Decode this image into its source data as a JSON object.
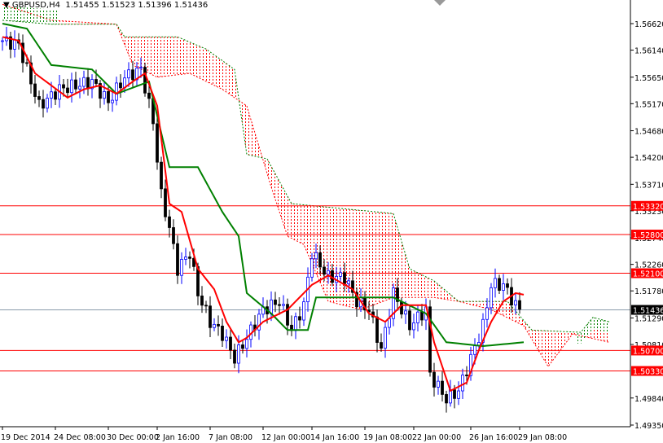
{
  "header": {
    "symbol": "GBPUSD,H4",
    "ohlc": "1.51455 1.51523 1.51396 1.51436"
  },
  "colors": {
    "bull": "#0000ff",
    "bear": "#000000",
    "tenkan": "#ff0000",
    "kijun": "#008000",
    "cloud_bear": "#ff0000",
    "cloud_bull": "#008000",
    "level": "#ff0000",
    "current": "#000000"
  },
  "chart_data": {
    "type": "candlestick",
    "title": "GBPUSD,H4",
    "ylim": [
      1.4935,
      1.5697
    ],
    "y_ticks": [
      "1.56620",
      "1.56140",
      "1.55650",
      "1.55170",
      "1.54680",
      "1.54200",
      "1.53710",
      "1.53230",
      "1.52740",
      "1.52260",
      "1.51780",
      "1.51290",
      "1.50810",
      "1.49840",
      "1.49350"
    ],
    "y_tick_values": [
      1.5662,
      1.5614,
      1.5565,
      1.5517,
      1.5468,
      1.542,
      1.5371,
      1.5323,
      1.5274,
      1.5226,
      1.5178,
      1.5129,
      1.5081,
      1.4984,
      1.4935
    ],
    "x_ticks": [
      "19 Dec 2014",
      "24 Dec 08:00",
      "30 Dec 00:00",
      "2 Jan 16:00",
      "7 Jan 08:00",
      "12 Jan 00:00",
      "14 Jan 16:00",
      "19 Jan 08:00",
      "22 Jan 00:00",
      "26 Jan 16:00",
      "29 Jan 08:00"
    ],
    "x_tick_bar_index": [
      0,
      13,
      26,
      38,
      51,
      64,
      76,
      89,
      101,
      115,
      127
    ],
    "levels": [
      {
        "value": 1.5332,
        "label": "1.53320"
      },
      {
        "value": 1.528,
        "label": "1.52800"
      },
      {
        "value": 1.521,
        "label": "1.52100"
      },
      {
        "value": 1.507,
        "label": "1.50700"
      },
      {
        "value": 1.5033,
        "label": "1.50330"
      }
    ],
    "current": {
      "value": 1.51436,
      "label": "1.51436"
    },
    "close_path": [
      [
        0,
        1.5631
      ],
      [
        4,
        1.5624
      ],
      [
        9,
        1.5513
      ],
      [
        14,
        1.5543
      ],
      [
        22,
        1.5557
      ],
      [
        26,
        1.552
      ],
      [
        30,
        1.5565
      ],
      [
        34,
        1.5579
      ],
      [
        37,
        1.5484
      ],
      [
        39,
        1.5351
      ],
      [
        41,
        1.5292
      ],
      [
        43,
        1.5218
      ],
      [
        46,
        1.5247
      ],
      [
        48,
        1.5174
      ],
      [
        51,
        1.5122
      ],
      [
        54,
        1.51
      ],
      [
        57,
        1.5056
      ],
      [
        60,
        1.5093
      ],
      [
        64,
        1.5144
      ],
      [
        68,
        1.5159
      ],
      [
        71,
        1.5107
      ],
      [
        74,
        1.5152
      ],
      [
        76,
        1.5247
      ],
      [
        80,
        1.5203
      ],
      [
        84,
        1.5203
      ],
      [
        87,
        1.5159
      ],
      [
        90,
        1.5144
      ],
      [
        93,
        1.5071
      ],
      [
        96,
        1.5174
      ],
      [
        100,
        1.5115
      ],
      [
        104,
        1.5144
      ],
      [
        105,
        1.5026
      ],
      [
        109,
        1.4982
      ],
      [
        112,
        1.4997
      ],
      [
        115,
        1.5056
      ],
      [
        118,
        1.5115
      ],
      [
        120,
        1.5189
      ],
      [
        123,
        1.5189
      ],
      [
        126,
        1.5152
      ],
      [
        127,
        1.5144
      ]
    ],
    "tenkan_path": [
      [
        0,
        1.5638
      ],
      [
        4,
        1.5631
      ],
      [
        8,
        1.5572
      ],
      [
        12,
        1.555
      ],
      [
        16,
        1.5528
      ],
      [
        20,
        1.5543
      ],
      [
        24,
        1.555
      ],
      [
        28,
        1.5535
      ],
      [
        32,
        1.5557
      ],
      [
        35,
        1.5572
      ],
      [
        38,
        1.5513
      ],
      [
        41,
        1.5336
      ],
      [
        44,
        1.5321
      ],
      [
        48,
        1.5218
      ],
      [
        52,
        1.5181
      ],
      [
        55,
        1.5122
      ],
      [
        58,
        1.5085
      ],
      [
        60,
        1.5093
      ],
      [
        64,
        1.5122
      ],
      [
        70,
        1.5144
      ],
      [
        76,
        1.5189
      ],
      [
        80,
        1.5206
      ],
      [
        86,
        1.5181
      ],
      [
        90,
        1.5137
      ],
      [
        94,
        1.5122
      ],
      [
        98,
        1.5152
      ],
      [
        104,
        1.5152
      ],
      [
        106,
        1.5085
      ],
      [
        110,
        1.4997
      ],
      [
        114,
        1.5012
      ],
      [
        117,
        1.5071
      ],
      [
        120,
        1.5122
      ],
      [
        123,
        1.5159
      ],
      [
        126,
        1.5174
      ],
      [
        128,
        1.5171
      ]
    ],
    "kijun_path": [
      [
        0,
        1.5662
      ],
      [
        6,
        1.5653
      ],
      [
        12,
        1.5587
      ],
      [
        22,
        1.5579
      ],
      [
        28,
        1.5535
      ],
      [
        36,
        1.5557
      ],
      [
        41,
        1.5402
      ],
      [
        48,
        1.5402
      ],
      [
        54,
        1.5321
      ],
      [
        58,
        1.5277
      ],
      [
        60,
        1.5174
      ],
      [
        66,
        1.5137
      ],
      [
        70,
        1.5107
      ],
      [
        75,
        1.5107
      ],
      [
        77,
        1.5166
      ],
      [
        96,
        1.5166
      ],
      [
        104,
        1.5137
      ],
      [
        109,
        1.5085
      ],
      [
        118,
        1.5078
      ],
      [
        128,
        1.5085
      ]
    ],
    "span_b_path": [
      [
        0,
        1.5668
      ],
      [
        12,
        1.5661
      ],
      [
        28,
        1.5661
      ],
      [
        30,
        1.5638
      ],
      [
        43,
        1.5638
      ],
      [
        50,
        1.5616
      ],
      [
        57,
        1.5579
      ],
      [
        60,
        1.5425
      ],
      [
        65,
        1.5417
      ],
      [
        71,
        1.5336
      ],
      [
        96,
        1.5318
      ],
      [
        100,
        1.5218
      ],
      [
        106,
        1.5196
      ],
      [
        112,
        1.5159
      ],
      [
        124,
        1.5159
      ],
      [
        130,
        1.5107
      ],
      [
        142,
        1.5103
      ],
      [
        145,
        1.513
      ],
      [
        149,
        1.5122
      ]
    ],
    "span_a_path": [
      [
        0,
        1.5697
      ],
      [
        12,
        1.5668
      ],
      [
        28,
        1.5661
      ],
      [
        32,
        1.5587
      ],
      [
        38,
        1.5565
      ],
      [
        46,
        1.5572
      ],
      [
        54,
        1.5543
      ],
      [
        60,
        1.5513
      ],
      [
        66,
        1.5366
      ],
      [
        70,
        1.5277
      ],
      [
        74,
        1.5262
      ],
      [
        80,
        1.5159
      ],
      [
        88,
        1.5144
      ],
      [
        96,
        1.5166
      ],
      [
        106,
        1.5166
      ],
      [
        112,
        1.5159
      ],
      [
        120,
        1.5144
      ],
      [
        128,
        1.5115
      ],
      [
        134,
        1.5041
      ],
      [
        140,
        1.51
      ],
      [
        149,
        1.5085
      ]
    ]
  }
}
